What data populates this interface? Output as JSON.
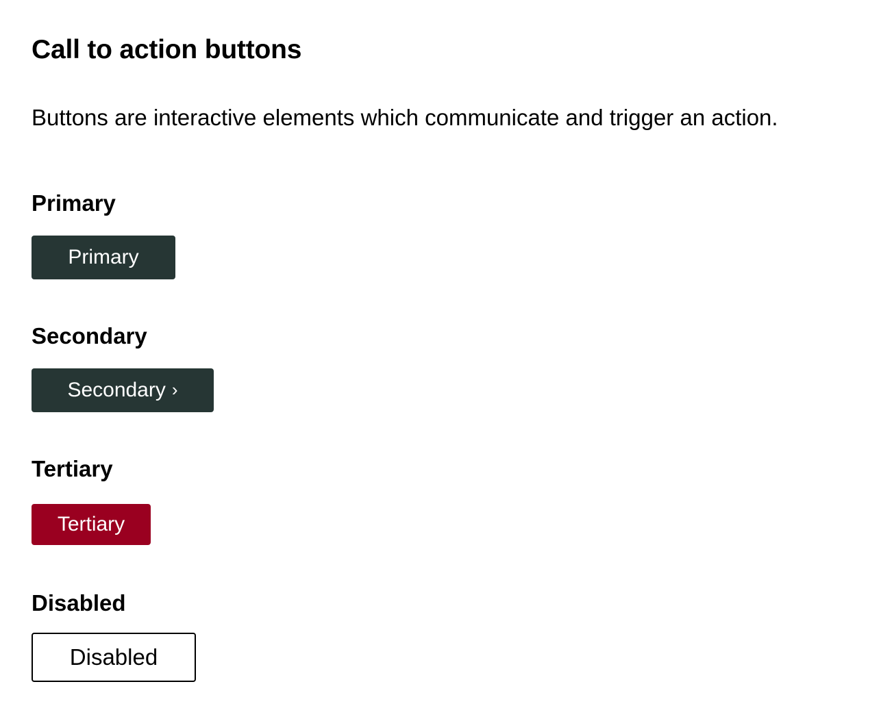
{
  "page": {
    "title": "Call to action buttons",
    "description": "Buttons are interactive elements which communicate and trigger an action."
  },
  "sections": {
    "primary": {
      "heading": "Primary",
      "button_label": "Primary",
      "color": "#263634"
    },
    "secondary": {
      "heading": "Secondary",
      "button_label": "Secondary",
      "icon": "chevron-right-icon",
      "color": "#263634"
    },
    "tertiary": {
      "heading": "Tertiary",
      "button_label": "Tertiary",
      "color": "#9a0020"
    },
    "disabled": {
      "heading": "Disabled",
      "button_label": "Disabled",
      "color": "#ffffff"
    }
  }
}
